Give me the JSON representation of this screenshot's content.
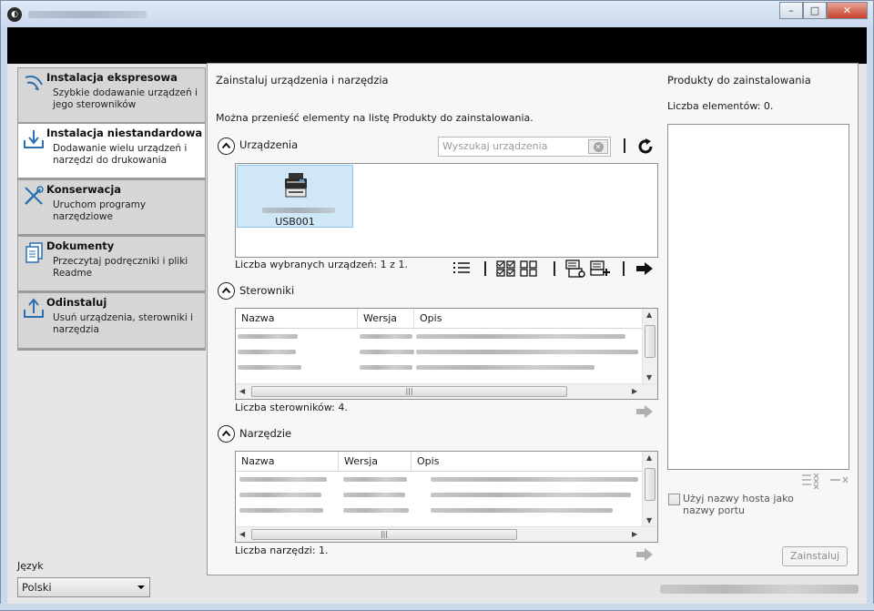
{
  "window": {
    "title": "Kyocera Product Library",
    "min_label": "–",
    "max_label": "□",
    "close_label": "✕"
  },
  "nav": {
    "items": [
      {
        "title": "Instalacja ekspresowa",
        "desc": "Szybkie dodawanie urządzeń i jego sterowników",
        "icon": "express-install-icon",
        "active": false
      },
      {
        "title": "Instalacja niestandardowa",
        "desc": "Dodawanie wielu urządzeń i narzędzi do drukowania",
        "icon": "custom-install-icon",
        "active": true
      },
      {
        "title": "Konserwacja",
        "desc": "Uruchom programy narzędziowe",
        "icon": "maintenance-icon",
        "active": false
      },
      {
        "title": "Dokumenty",
        "desc": "Przeczytaj podręczniki i pliki Readme",
        "icon": "documents-icon",
        "active": false
      },
      {
        "title": "Odinstaluj",
        "desc": "Usuń urządzenia, sterowniki i narzędzia",
        "icon": "uninstall-icon",
        "active": false
      }
    ]
  },
  "language": {
    "label": "Język",
    "value": "Polski"
  },
  "main": {
    "title": "Zainstaluj urządzenia i narzędzia",
    "hint": "Można przenieść elementy na listę Produkty do zainstalowania.",
    "devices": {
      "label": "Urządzenia",
      "search_placeholder": "Wyszukaj urządzenia",
      "items": [
        {
          "label": "USB001"
        }
      ],
      "count": "Liczba wybranych urządzeń: 1 z 1."
    },
    "drivers": {
      "label": "Sterowniki",
      "columns": [
        "Nazwa",
        "Wersja",
        "Opis"
      ],
      "count": "Liczba sterowników: 4."
    },
    "tools": {
      "label": "Narzędzie",
      "columns": [
        "Nazwa",
        "Wersja",
        "Opis"
      ],
      "count": "Liczba narzędzi: 1."
    }
  },
  "products": {
    "title": "Produkty do zainstalowania",
    "count": "Liczba elementów: 0.",
    "hostname_label": "Użyj nazwy hosta jako nazwy portu",
    "install_label": "Zainstaluj"
  },
  "colors": {
    "accent": "#cfe7f7",
    "banner": "#000000",
    "panel": "#f7f7f7"
  }
}
